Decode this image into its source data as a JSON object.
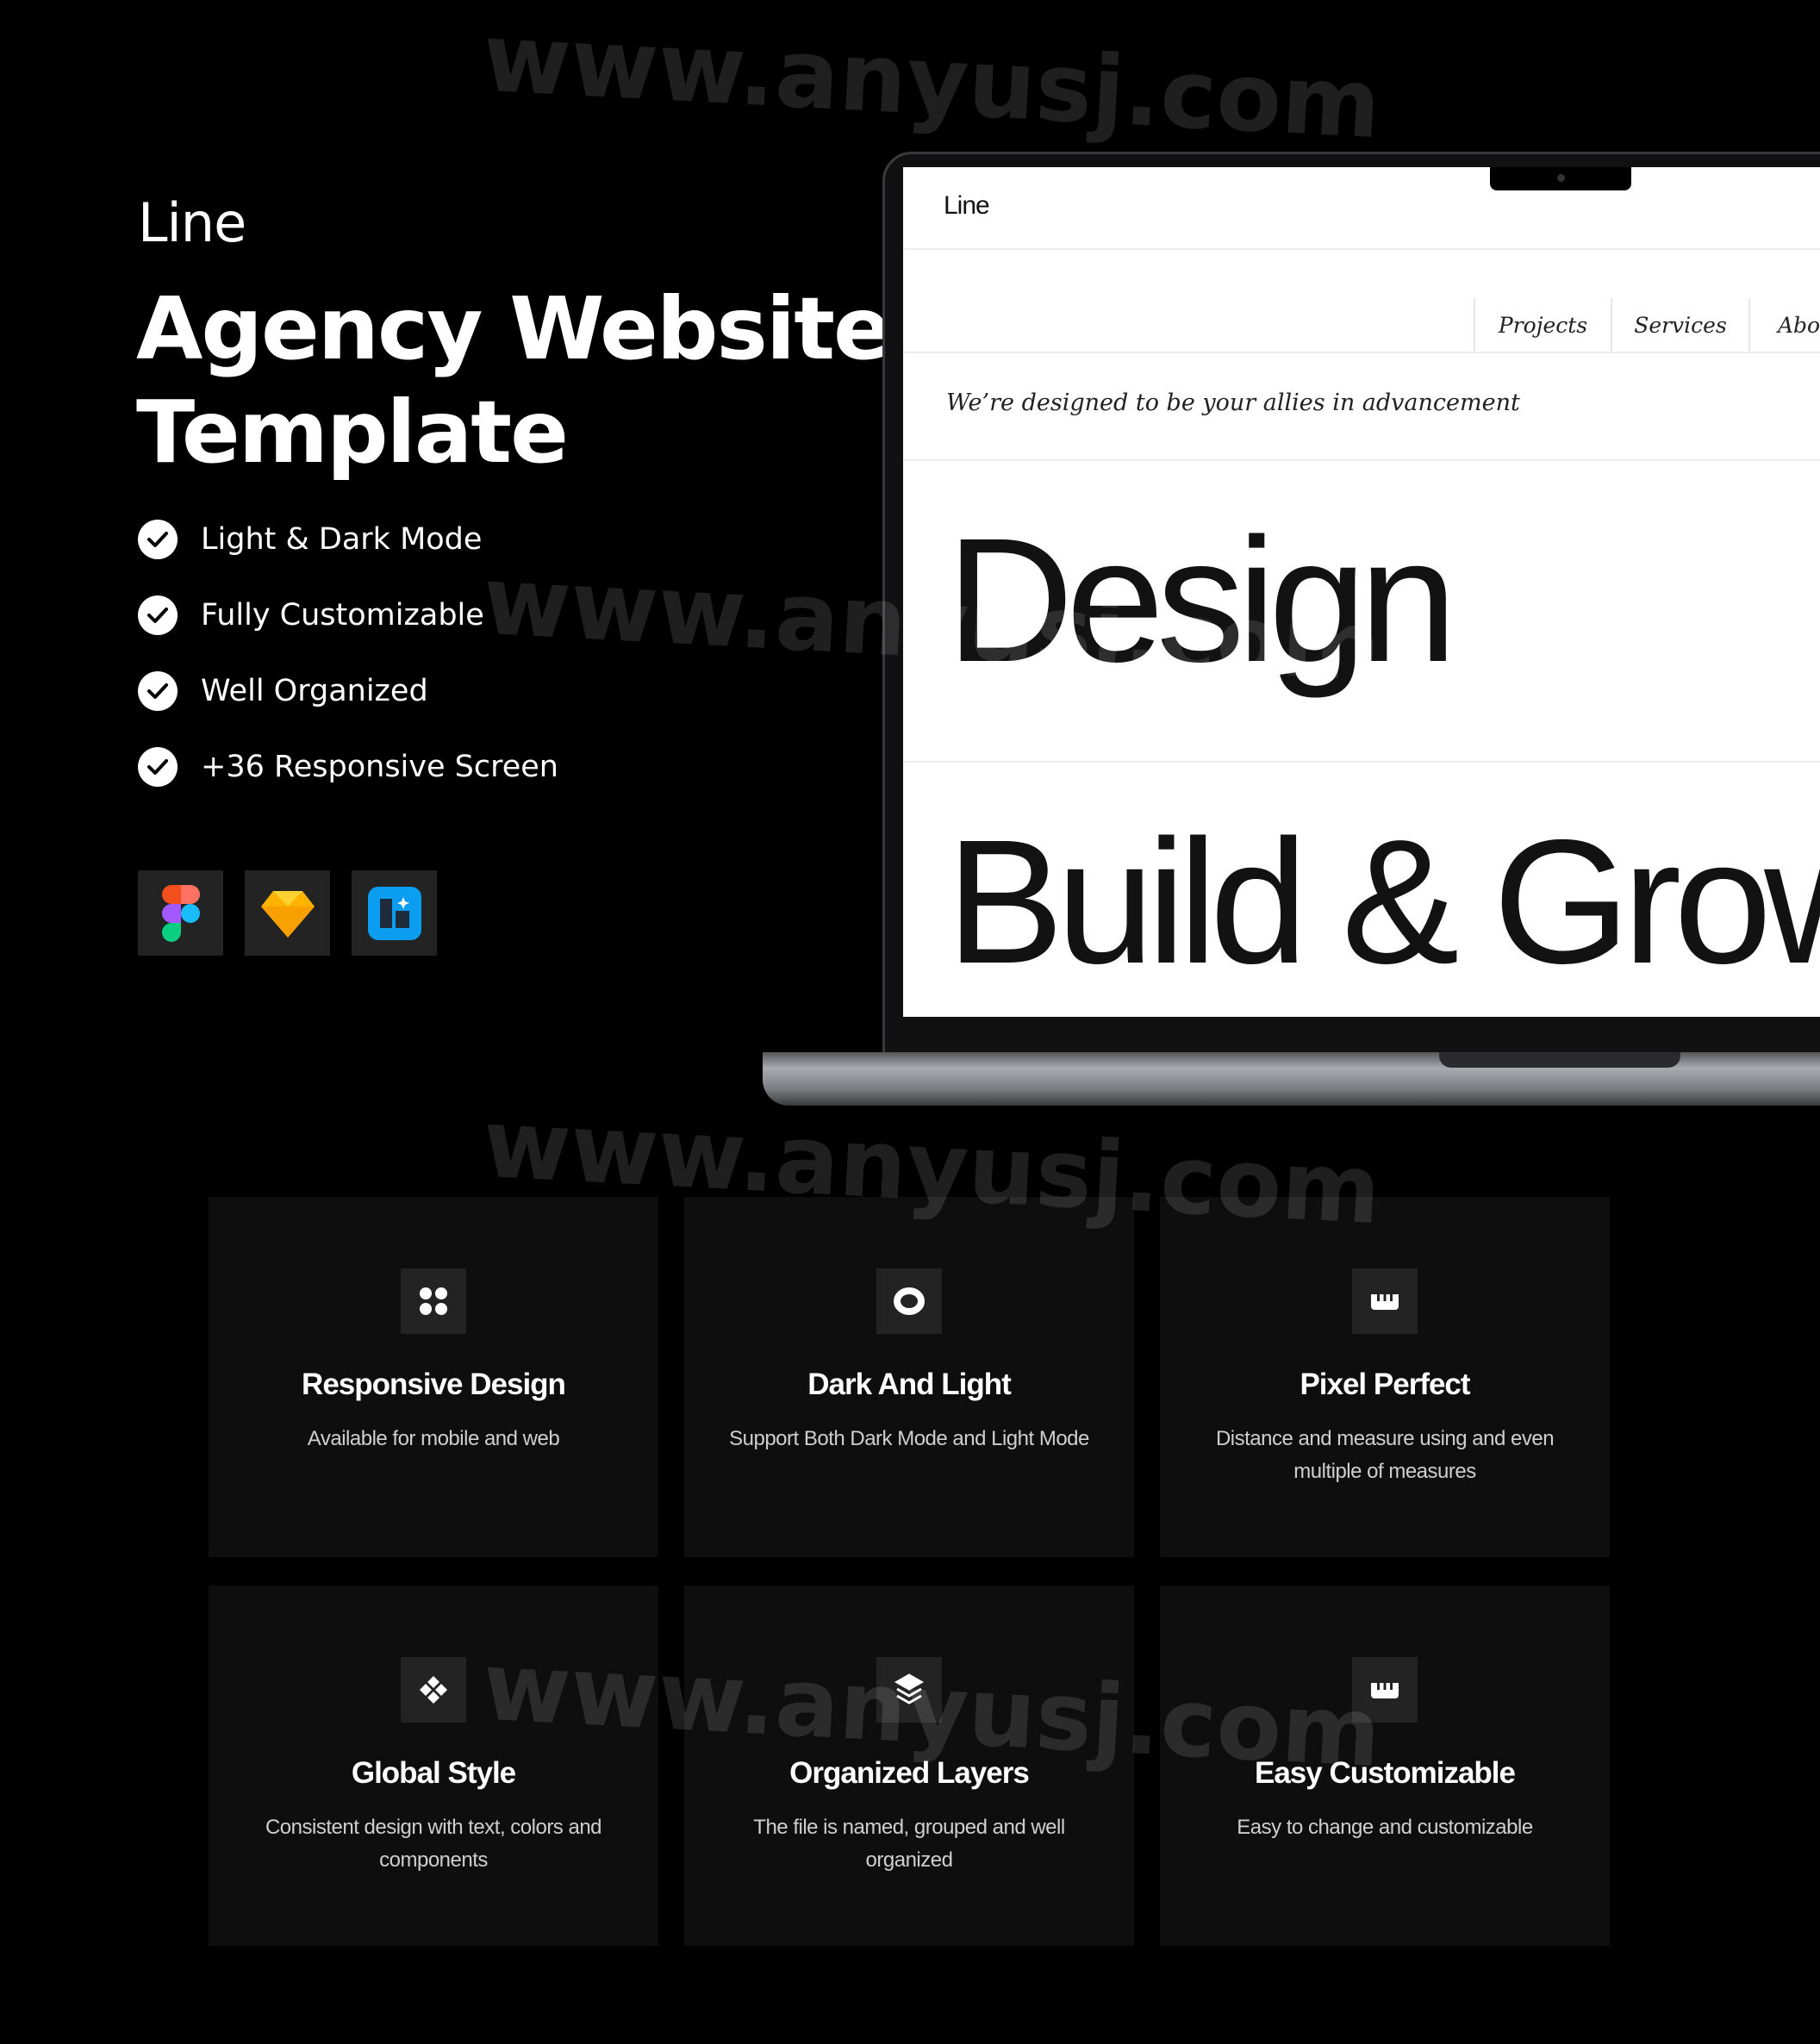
{
  "brand": {
    "logo": "Line"
  },
  "hero": {
    "title_line1": "Agency Website",
    "title_line2": "Template"
  },
  "features_list": [
    "Light & Dark Mode",
    "Fully Customizable",
    "Well Organized",
    "+36 Responsive Screen"
  ],
  "tools": [
    {
      "icon": "figma-icon"
    },
    {
      "icon": "sketch-icon"
    },
    {
      "icon": "builder-icon",
      "color": "#0a9df0"
    }
  ],
  "preview": {
    "logo": "Line",
    "nav": [
      "Projects",
      "Services",
      "About"
    ],
    "tagline": "We’re designed to be your allies in advancement",
    "headline1": "Design",
    "headline2": "Build & Grow"
  },
  "cards": [
    {
      "icon": "grid-dots-icon",
      "title": "Responsive Design",
      "desc": "Available for mobile and web"
    },
    {
      "icon": "toggle-ring-icon",
      "title": "Dark And Light",
      "desc": "Support Both Dark Mode and Light Mode"
    },
    {
      "icon": "ruler-icon",
      "title": "Pixel Perfect",
      "desc": "Distance and measure using and even multiple of measures"
    },
    {
      "icon": "component-icon",
      "title": "Global Style",
      "desc": "Consistent design with text, colors and components"
    },
    {
      "icon": "layers-icon",
      "title": "Organized Layers",
      "desc": "The file is named, grouped and well organized"
    },
    {
      "icon": "ruler-icon",
      "title": "Easy Customizable",
      "desc": "Easy to change and customizable"
    }
  ],
  "watermark": "www.anyusj.com"
}
